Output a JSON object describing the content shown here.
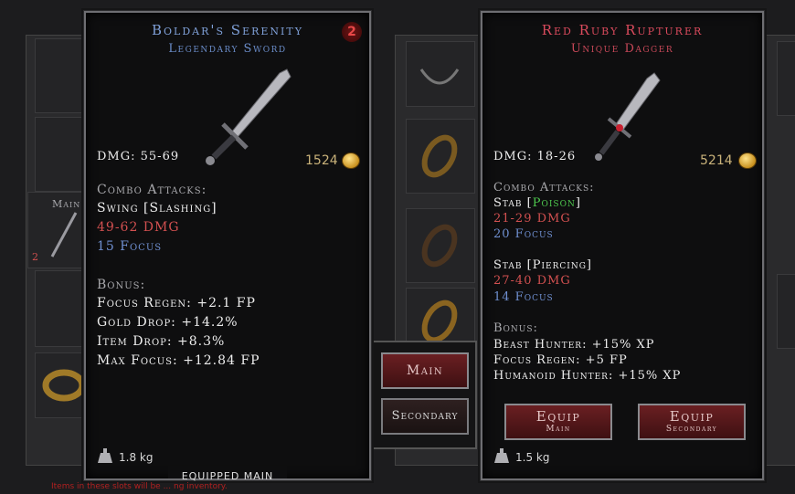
{
  "left_tooltip": {
    "name": "Boldar's Serenity",
    "type": "Legendary Sword",
    "badge": "2",
    "damage": "DMG: 55-69",
    "price": "1524",
    "combo_header": "Combo Attacks:",
    "attack_name": "Swing [Slashing]",
    "attack_damage": "49-62 DMG",
    "attack_focus": "15 Focus",
    "bonus_header": "Bonus:",
    "bonuses": [
      "Focus Regen: +2.1 FP",
      "Gold Drop: +14.2%",
      "Item Drop: +8.3%",
      "Max Focus: +12.84 FP"
    ],
    "weight": "1.8 kg",
    "footer": "Equipped Main"
  },
  "right_tooltip": {
    "name": "Red Ruby Rupturer",
    "type": "Unique Dagger",
    "damage": "DMG: 18-26",
    "price": "5214",
    "combo_header": "Combo Attacks:",
    "attack1_prefix": "Stab [",
    "attack1_effect": "Poison",
    "attack1_suffix": "]",
    "attack1_damage": "21-29 DMG",
    "attack1_focus": "20 Focus",
    "attack2_name": "Stab [Piercing]",
    "attack2_damage": "27-40 DMG",
    "attack2_focus": "14 Focus",
    "bonus_header": "Bonus:",
    "bonuses": [
      "Beast Hunter: +15% XP",
      "Focus Regen: +5 FP",
      "Humanoid Hunter: +15% XP"
    ],
    "equip_main_label": "Equip",
    "equip_main_sub": "Main",
    "equip_secondary_label": "Equip",
    "equip_secondary_sub": "Secondary",
    "weight": "1.5 kg"
  },
  "middle_buttons": {
    "main": "Main",
    "secondary": "Secondary"
  },
  "sidebar": {
    "main_label": "Main",
    "slot_badge": "2"
  },
  "footer_hint": "Items in these slots will be ... ng inventory."
}
